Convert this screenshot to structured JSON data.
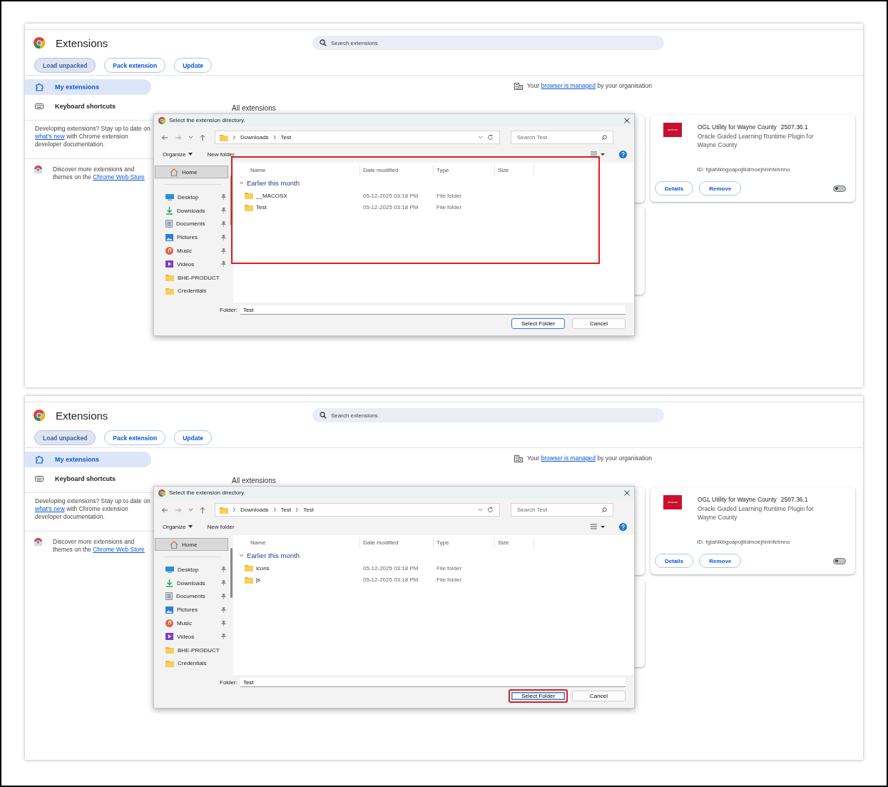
{
  "screens": [
    {
      "page": {
        "title": "Extensions",
        "search_placeholder": "Search extensions",
        "toolbar": [
          {
            "label": "Load unpacked",
            "selected": true
          },
          {
            "label": "Pack extension",
            "selected": false
          },
          {
            "label": "Update",
            "selected": false
          }
        ],
        "sidebar": [
          {
            "label": "My extensions",
            "kind": "puzzle",
            "selected": true
          },
          {
            "label": "Keyboard shortcuts",
            "kind": "keyboard",
            "selected": false
          }
        ],
        "dev_note": {
          "before": "Developing extensions? Stay up to date on ",
          "link": "what's new",
          "after": " with Chrome extension developer documentation."
        },
        "store_note": {
          "before": "Discover more extensions and themes on the ",
          "link": "Chrome Web Store"
        },
        "managed": {
          "before": "Your ",
          "link": "browser is managed",
          "after": " by your organisation"
        },
        "section_heading": "All extensions",
        "card": {
          "name": "OGL Utility for Wayne County",
          "version": "2507.36.1",
          "description": "Oracle Guided Learning Runtime Plugin for Wayne County",
          "id": "ID: fgiahlkbgoapojliidmoejhinhfebnno",
          "buttons": [
            "Details",
            "Remove"
          ],
          "enabled": false
        }
      },
      "dialog": {
        "title": "Select the extension directory.",
        "path": [
          "Downloads",
          "Test"
        ],
        "search_placeholder": "Search Test",
        "organize": "Organize",
        "new_folder": "New folder",
        "nav": [
          {
            "label": "Home",
            "kind": "home",
            "pinned": false,
            "selected": true
          },
          {
            "label": "Desktop",
            "kind": "desktop",
            "pinned": true,
            "selected": false
          },
          {
            "label": "Downloads",
            "kind": "download",
            "pinned": true,
            "selected": false
          },
          {
            "label": "Documents",
            "kind": "documents",
            "pinned": true,
            "selected": false
          },
          {
            "label": "Pictures",
            "kind": "pictures",
            "pinned": true,
            "selected": false
          },
          {
            "label": "Music",
            "kind": "music",
            "pinned": true,
            "selected": false
          },
          {
            "label": "Videos",
            "kind": "videos",
            "pinned": true,
            "selected": false
          },
          {
            "label": "BHE-PRODUCT",
            "kind": "folder",
            "pinned": false,
            "selected": false
          },
          {
            "label": "Credentials",
            "kind": "folder",
            "pinned": false,
            "selected": false
          }
        ],
        "columns": [
          "Name",
          "Date modified",
          "Type",
          "Size"
        ],
        "group": "Earlier this month",
        "files": [
          {
            "name": "__MACOSX",
            "date": "05-12-2025 03:18 PM",
            "type": "File folder"
          },
          {
            "name": "Test",
            "date": "05-12-2025 03:18 PM",
            "type": "File folder"
          }
        ],
        "folder_label": "Folder:",
        "folder_value": "Test",
        "buttons": [
          "Select Folder",
          "Cancel"
        ],
        "file_list_highlighted": true,
        "select_button_highlighted": false
      }
    },
    {
      "page": {
        "title": "Extensions",
        "search_placeholder": "Search extensions",
        "toolbar": [
          {
            "label": "Load unpacked",
            "selected": true
          },
          {
            "label": "Pack extension",
            "selected": false
          },
          {
            "label": "Update",
            "selected": false
          }
        ],
        "sidebar": [
          {
            "label": "My extensions",
            "kind": "puzzle",
            "selected": true
          },
          {
            "label": "Keyboard shortcuts",
            "kind": "keyboard",
            "selected": false
          }
        ],
        "dev_note": {
          "before": "Developing extensions? Stay up to date on ",
          "link": "what's new",
          "after": " with Chrome extension developer documentation."
        },
        "store_note": {
          "before": "Discover more extensions and themes on the ",
          "link": "Chrome Web Store"
        },
        "managed": {
          "before": "Your ",
          "link": "browser is managed",
          "after": " by your organisation"
        },
        "section_heading": "All extensions",
        "card": {
          "name": "OGL Utility for Wayne County",
          "version": "2507.36.1",
          "description": "Oracle Guided Learning Runtime Plugin for Wayne County",
          "id": "ID: fgiahlkbgoapojliidmoejhinhfebnno",
          "buttons": [
            "Details",
            "Remove"
          ],
          "enabled": false
        }
      },
      "dialog": {
        "title": "Select the extension directory.",
        "path": [
          "Downloads",
          "Test",
          "Test"
        ],
        "search_placeholder": "Search Test",
        "organize": "Organize",
        "new_folder": "New folder",
        "nav": [
          {
            "label": "Home",
            "kind": "home",
            "pinned": false,
            "selected": true
          },
          {
            "label": "Desktop",
            "kind": "desktop",
            "pinned": true,
            "selected": false
          },
          {
            "label": "Downloads",
            "kind": "download",
            "pinned": true,
            "selected": false
          },
          {
            "label": "Documents",
            "kind": "documents",
            "pinned": true,
            "selected": false
          },
          {
            "label": "Pictures",
            "kind": "pictures",
            "pinned": true,
            "selected": false
          },
          {
            "label": "Music",
            "kind": "music",
            "pinned": true,
            "selected": false
          },
          {
            "label": "Videos",
            "kind": "videos",
            "pinned": true,
            "selected": false
          },
          {
            "label": "BHE-PRODUCT",
            "kind": "folder",
            "pinned": false,
            "selected": false
          },
          {
            "label": "Credentials",
            "kind": "folder",
            "pinned": false,
            "selected": false
          }
        ],
        "columns": [
          "Name",
          "Date modified",
          "Type",
          "Size"
        ],
        "group": "Earlier this month",
        "files": [
          {
            "name": "icons",
            "date": "05-12-2025 03:18 PM",
            "type": "File folder"
          },
          {
            "name": "js",
            "date": "05-12-2025 03:18 PM",
            "type": "File folder"
          }
        ],
        "folder_label": "Folder:",
        "folder_value": "Test",
        "buttons": [
          "Select Folder",
          "Cancel"
        ],
        "file_list_highlighted": false,
        "select_button_highlighted": true
      }
    }
  ]
}
